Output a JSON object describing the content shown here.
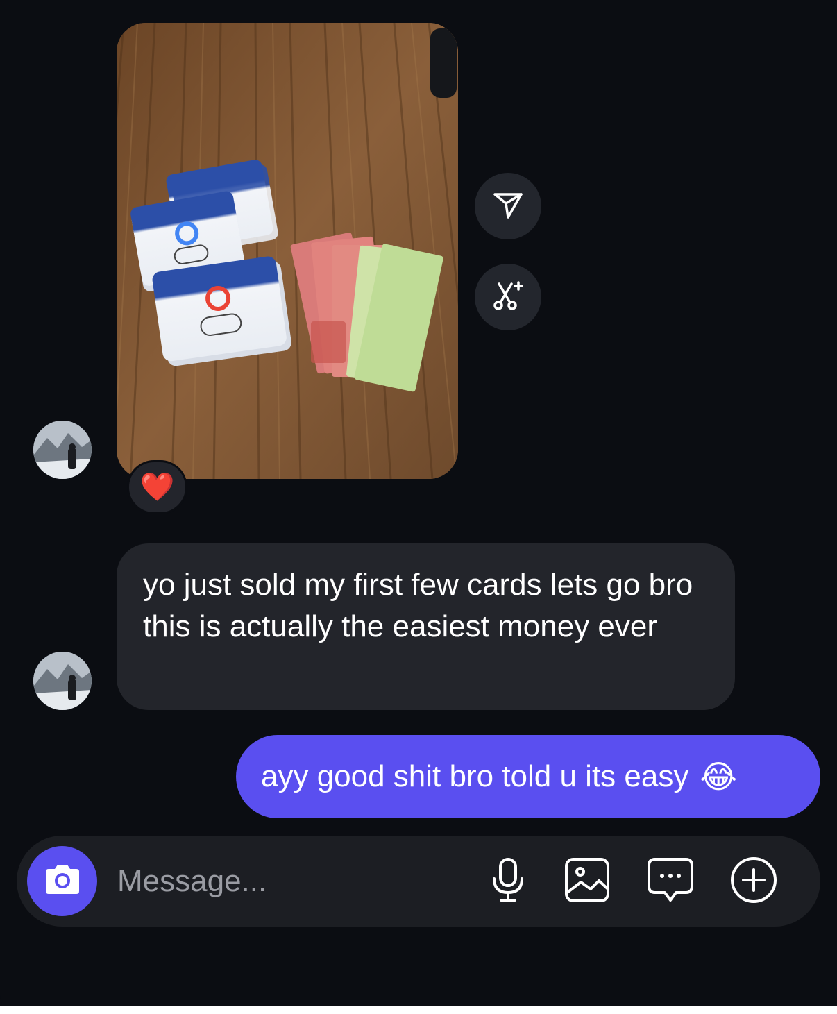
{
  "thread": {
    "messages": [
      {
        "sender": "other",
        "type": "photo",
        "reaction": "❤️"
      },
      {
        "sender": "other",
        "type": "text",
        "text": "yo just sold my first few cards lets go bro this is actually the easiest money ever"
      },
      {
        "sender": "me",
        "type": "text",
        "text": "ayy good shit bro told u its easy",
        "emoji": "😂"
      }
    ],
    "photo_actions": [
      "share-icon",
      "ai-edit-icon"
    ]
  },
  "composer": {
    "placeholder": "Message...",
    "icons": [
      "camera-icon",
      "microphone-icon",
      "gallery-icon",
      "sticker-chat-icon",
      "plus-icon"
    ]
  },
  "colors": {
    "background": "#0b0d12",
    "incoming_bubble": "#23252b",
    "outgoing_bubble": "#5a4ff0",
    "composer": "#1c1e23",
    "placeholder": "#9a9ca3"
  }
}
